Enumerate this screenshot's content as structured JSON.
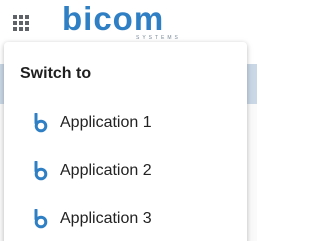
{
  "header": {
    "apps_menu_icon": "grid-icon",
    "logo": {
      "text": "bicom",
      "subtext": "SYSTEMS",
      "color": "#2f7fc4"
    }
  },
  "switcher": {
    "title": "Switch to",
    "items": [
      {
        "label": "Application 1",
        "icon": "bicom-b-icon"
      },
      {
        "label": "Application 2",
        "icon": "bicom-b-icon"
      },
      {
        "label": "Application 3",
        "icon": "bicom-b-icon"
      }
    ],
    "accent_color": "#2f7fc4"
  }
}
